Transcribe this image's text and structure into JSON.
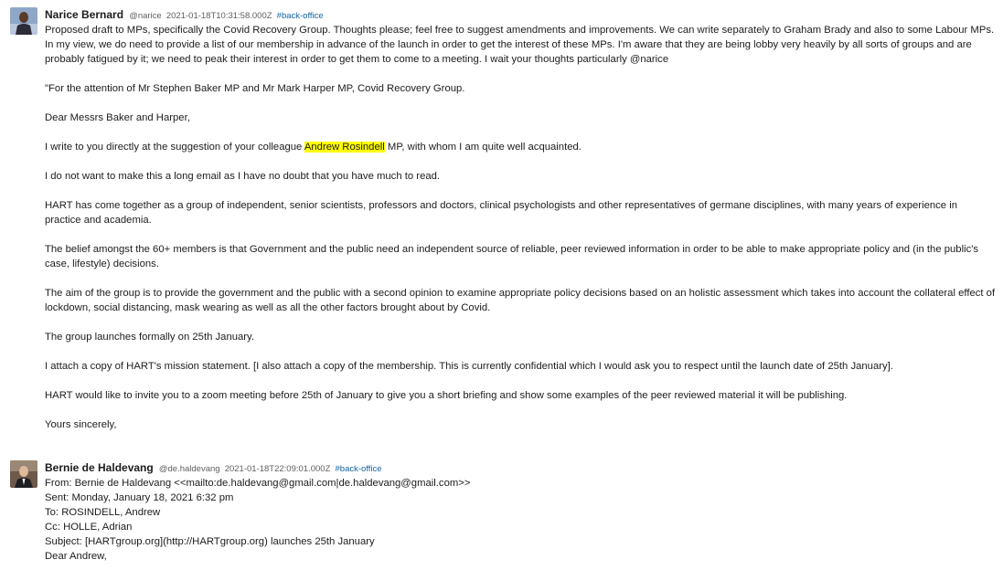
{
  "messages": [
    {
      "author": "Narice Bernard",
      "handle": "@narice",
      "timestamp": "2021-01-18T10:31:58.000Z",
      "channel": "#back-office",
      "paragraphs": [
        "Proposed draft to MPs, specifically the Covid Recovery Group. Thoughts please; feel free to suggest amendments and improvements. We can write separately to Graham Brady and also to some Labour MPs. In my view, we do need to provide a list of our membership in advance of the launch in order to get the interest of these MPs. I'm aware that they are being lobby very heavily by all sorts of groups and are probably fatigued by it; we need to peak their interest in order to get them to come to a meeting. I wait your thoughts particularly @narice",
        "\"For the attention of Mr Stephen Baker MP and Mr Mark Harper MP, Covid Recovery Group.",
        "Dear Messrs Baker and Harper,"
      ],
      "highlight_paragraph": {
        "before": "I write to you directly at the suggestion of your colleague ",
        "highlight": "Andrew Rosindell",
        "after": " MP, with whom I am quite well acquainted."
      },
      "paragraphs_after": [
        "I do not want to make this a long email as I have no doubt that you have much to read.",
        "HART has come together as a group of independent, senior scientists, professors and doctors, clinical psychologists and other representatives of germane disciplines, with many years of experience in practice and academia.",
        "The belief amongst the 60+ members is that Government and the public need an independent source of reliable, peer reviewed information in order to be able to make appropriate policy and (in the public's case, lifestyle) decisions.",
        "The aim of the group is to provide the government and the public with a second opinion to examine appropriate policy decisions based on an holistic assessment which takes into account the collateral effect of lockdown, social distancing, mask wearing as well as all the other factors brought about by Covid.",
        "The group launches formally on 25th January.",
        "I attach a copy of HART's mission statement. [I also attach a copy of the membership. This is currently confidential which I would ask you to respect until the launch date of 25th January].",
        "HART would like to invite you to a zoom meeting before 25th of January to give you a short briefing and show some examples of the peer reviewed material it will be publishing.",
        "Yours sincerely,"
      ]
    },
    {
      "author": "Bernie de Haldevang",
      "handle": "@de.haldevang",
      "timestamp": "2021-01-18T22:09:01.000Z",
      "channel": "#back-office",
      "lines": [
        "From: Bernie de Haldevang <<mailto:de.haldevang@gmail.com|de.haldevang@gmail.com>>",
        "Sent: Monday, January 18, 2021 6:32 pm",
        "To: ROSINDELL, Andrew",
        "Cc: HOLLE, Adrian",
        "Subject: [HARTgroup.org](http://HARTgroup.org) launches 25th January",
        "Dear Andrew,"
      ]
    }
  ]
}
